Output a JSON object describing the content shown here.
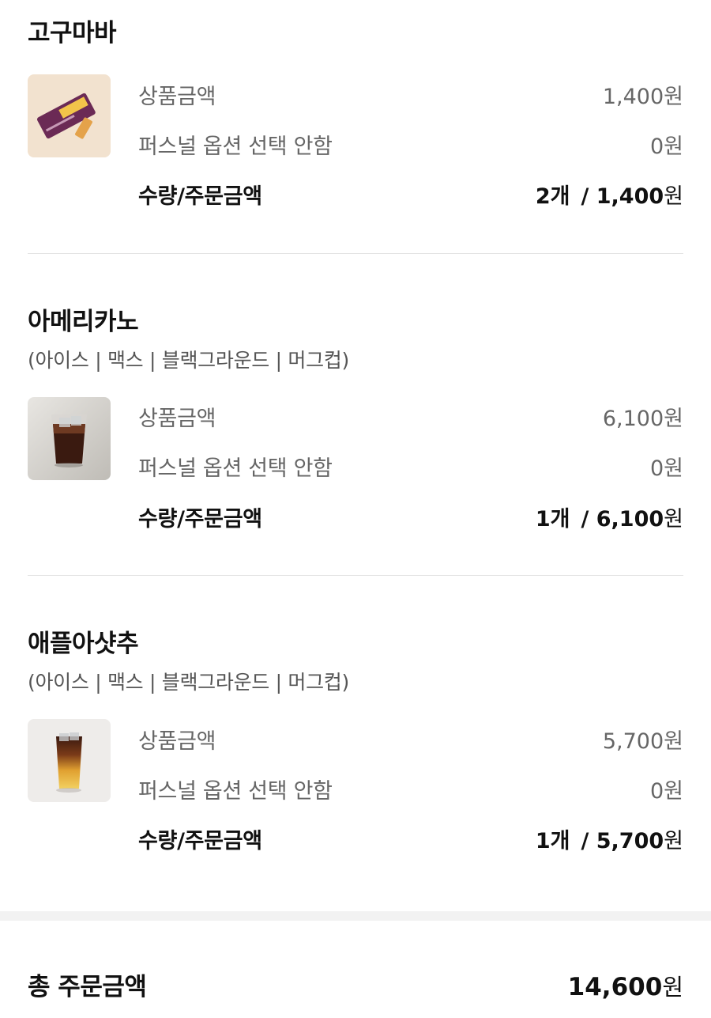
{
  "items": [
    {
      "name": "고구마바",
      "options": "",
      "price_label": "상품금액",
      "price": "1,400",
      "personal_label": "퍼스널 옵션 선택 안함",
      "personal_price": "0",
      "total_label": "수량/주문금액",
      "qty": "2개",
      "total": "/ 1,400"
    },
    {
      "name": "아메리카노",
      "options": "(아이스 | 맥스 | 블랙그라운드 | 머그컵)",
      "price_label": "상품금액",
      "price": "6,100",
      "personal_label": "퍼스널 옵션 선택 안함",
      "personal_price": "0",
      "total_label": "수량/주문금액",
      "qty": "1개",
      "total": "/ 6,100"
    },
    {
      "name": "애플아샷추",
      "options": "(아이스 | 맥스 | 블랙그라운드 | 머그컵)",
      "price_label": "상품금액",
      "price": "5,700",
      "personal_label": "퍼스널 옵션 선택 안함",
      "personal_price": "0",
      "total_label": "수량/주문금액",
      "qty": "1개",
      "total": "/ 5,700"
    }
  ],
  "currency": "원",
  "grand_total": {
    "label": "총 주문금액",
    "value": "14,600"
  }
}
